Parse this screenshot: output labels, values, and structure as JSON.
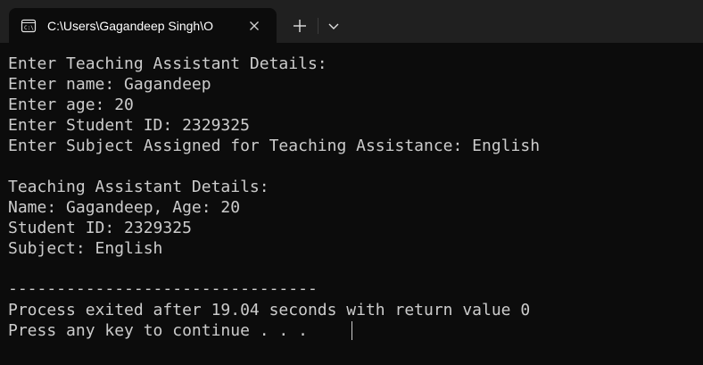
{
  "tab": {
    "title": "C:\\Users\\Gagandeep Singh\\O",
    "icon": "terminal-window-icon"
  },
  "toolbar": {
    "new_tab_icon": "plus-icon",
    "dropdown_icon": "chevron-down-icon"
  },
  "colors": {
    "background": "#0c0c0c",
    "titlebar": "#202020",
    "text": "#cccccc"
  },
  "terminal": {
    "lines": [
      "Enter Teaching Assistant Details:",
      "Enter name: Gagandeep",
      "Enter age: 20",
      "Enter Student ID: 2329325",
      "Enter Subject Assigned for Teaching Assistance: English",
      "",
      "Teaching Assistant Details:",
      "Name: Gagandeep, Age: 20",
      "Student ID: 2329325",
      "Subject: English",
      "",
      "--------------------------------",
      "Process exited after 19.04 seconds with return value 0",
      "Press any key to continue . . . "
    ]
  }
}
